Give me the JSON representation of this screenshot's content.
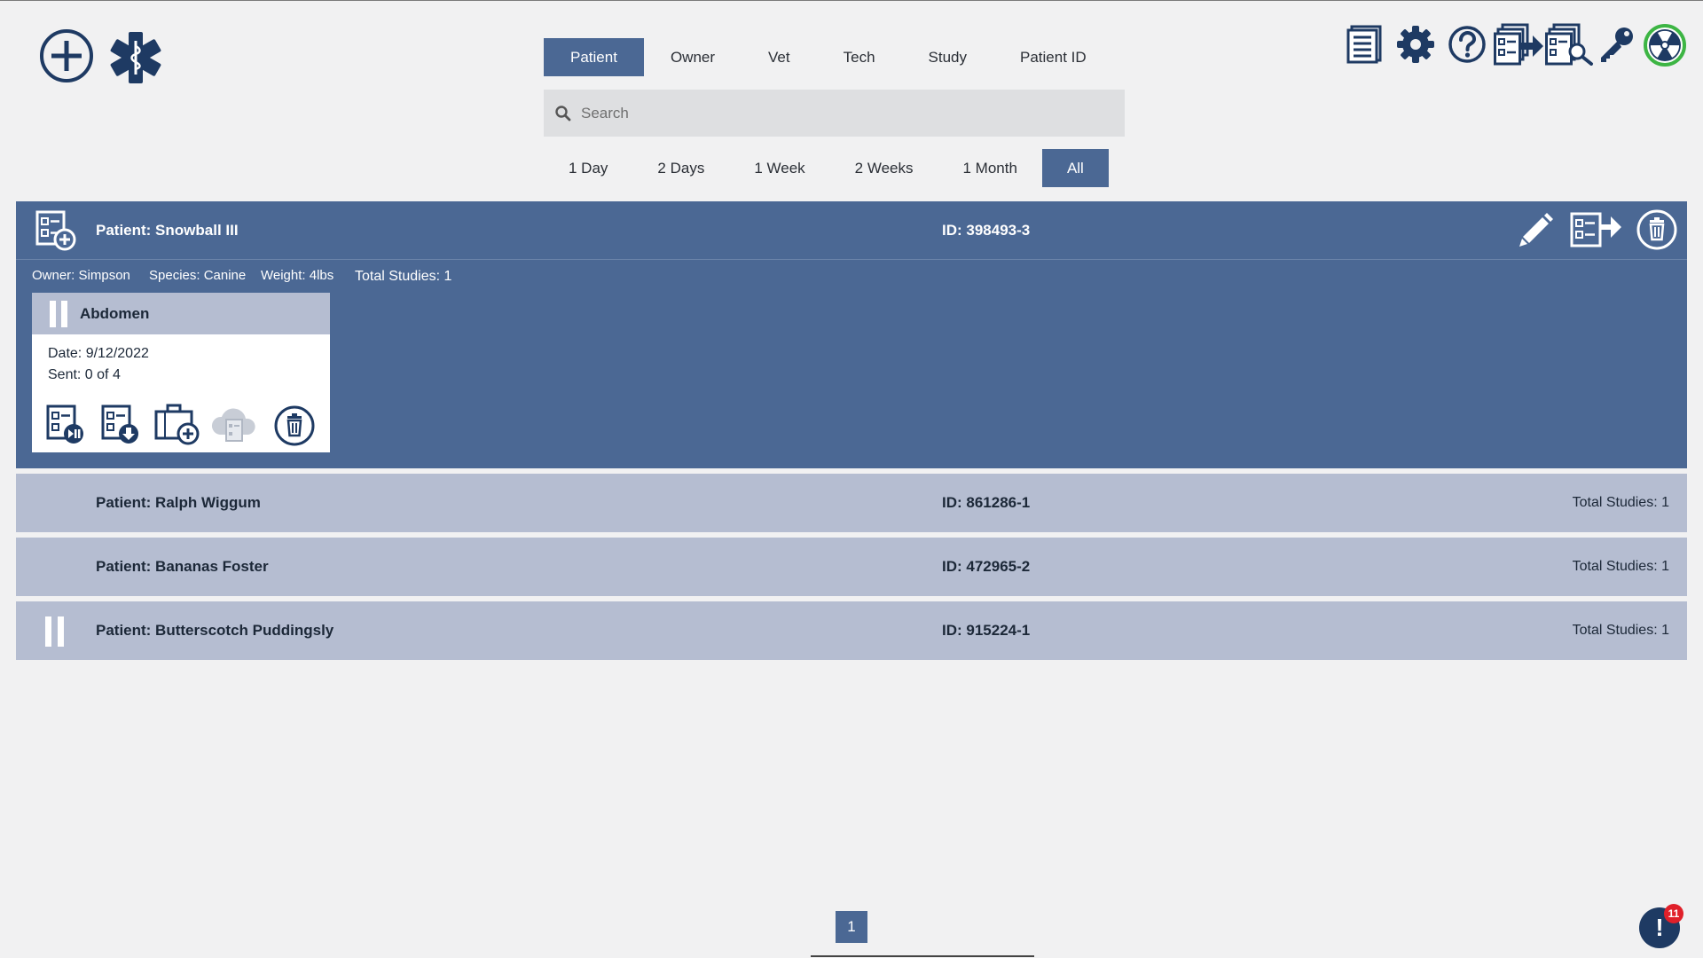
{
  "search": {
    "tabs": [
      {
        "label": "Patient",
        "active": true
      },
      {
        "label": "Owner",
        "active": false
      },
      {
        "label": "Vet",
        "active": false
      },
      {
        "label": "Tech",
        "active": false
      },
      {
        "label": "Study",
        "active": false
      },
      {
        "label": "Patient ID",
        "active": false
      }
    ],
    "placeholder": "Search",
    "value": "",
    "ranges": [
      {
        "label": "1 Day",
        "active": false
      },
      {
        "label": "2 Days",
        "active": false
      },
      {
        "label": "1 Week",
        "active": false
      },
      {
        "label": "2 Weeks",
        "active": false
      },
      {
        "label": "1 Month",
        "active": false
      },
      {
        "label": "All",
        "active": true
      }
    ]
  },
  "toolbar": {
    "left_icons": [
      "add-circle-icon",
      "star-of-life-icon"
    ],
    "right_icons": [
      "document-list-icon",
      "gear-icon",
      "help-icon",
      "send-studies-icon",
      "search-studies-icon",
      "key-icon",
      "radiation-icon"
    ]
  },
  "patients": {
    "expanded": {
      "name": "Patient: Snowball III",
      "id": "ID: 398493-3",
      "owner": "Owner: Simpson",
      "species": "Species: Canine",
      "weight": "Weight: 4lbs",
      "total_studies": "Total Studies: 1",
      "study": {
        "title": "Abdomen",
        "date": "Date: 9/12/2022",
        "sent": "Sent: 0 of 4"
      }
    },
    "rows": [
      {
        "name": "Patient: Ralph Wiggum",
        "id": "ID: 861286-1",
        "total_studies": "Total Studies: 1"
      },
      {
        "name": "Patient: Bananas Foster",
        "id": "ID: 472965-2",
        "total_studies": "Total Studies: 1"
      },
      {
        "name": "Patient: Butterscotch Puddingsly",
        "id": "ID: 915224-1",
        "total_studies": "Total Studies: 1"
      }
    ]
  },
  "pagination": {
    "current": "1"
  },
  "notifications": {
    "count": "11",
    "mark": "!"
  },
  "colors": {
    "accent": "#4b6894",
    "row": "#b5bdd1",
    "dark": "#1e3a63",
    "badge": "#e0202a",
    "active_ring": "#3db544"
  }
}
